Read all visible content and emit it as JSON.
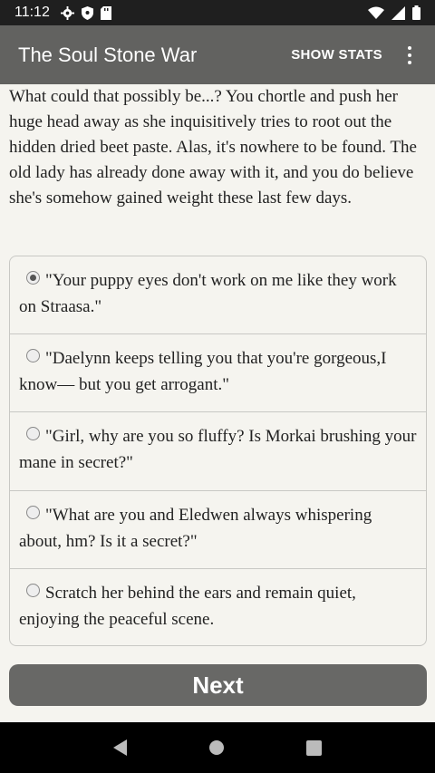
{
  "status_bar": {
    "time": "11:12",
    "left_icons": [
      "gear-icon",
      "shield-icon",
      "sd-card-icon"
    ],
    "right_icons": [
      "wifi-icon",
      "signal-icon",
      "battery-icon"
    ]
  },
  "app_bar": {
    "title": "The Soul Stone War",
    "show_stats_label": "SHOW STATS",
    "overflow_icon": "more-vert-icon"
  },
  "story": {
    "text": "What could that possibly be...? You chortle and push her huge head away as she inquisitively tries to root out the hidden dried beet paste. Alas, it's nowhere to be found. The old lady has already done away with it, and you do believe she's somehow gained weight these last few days."
  },
  "choices": [
    {
      "label": "\"Your puppy eyes don't work on me like they work on Straasa.\"",
      "selected": true
    },
    {
      "label": "\"Daelynn keeps telling you that you're gorgeous,I know— but you get arrogant.\"",
      "selected": false
    },
    {
      "label": "\"Girl, why are you so fluffy? Is Morkai brushing your mane in secret?\"",
      "selected": false
    },
    {
      "label": "\"What are you and Eledwen always whispering about, hm? Is it a secret?\"",
      "selected": false
    },
    {
      "label": "Scratch her behind the ears and remain quiet, enjoying the peaceful scene.",
      "selected": false
    }
  ],
  "next_button": {
    "label": "Next"
  },
  "colors": {
    "app_bar": "#626260",
    "status_bar": "#1f1f1f",
    "background": "#f5f4ef",
    "button": "#686866"
  }
}
